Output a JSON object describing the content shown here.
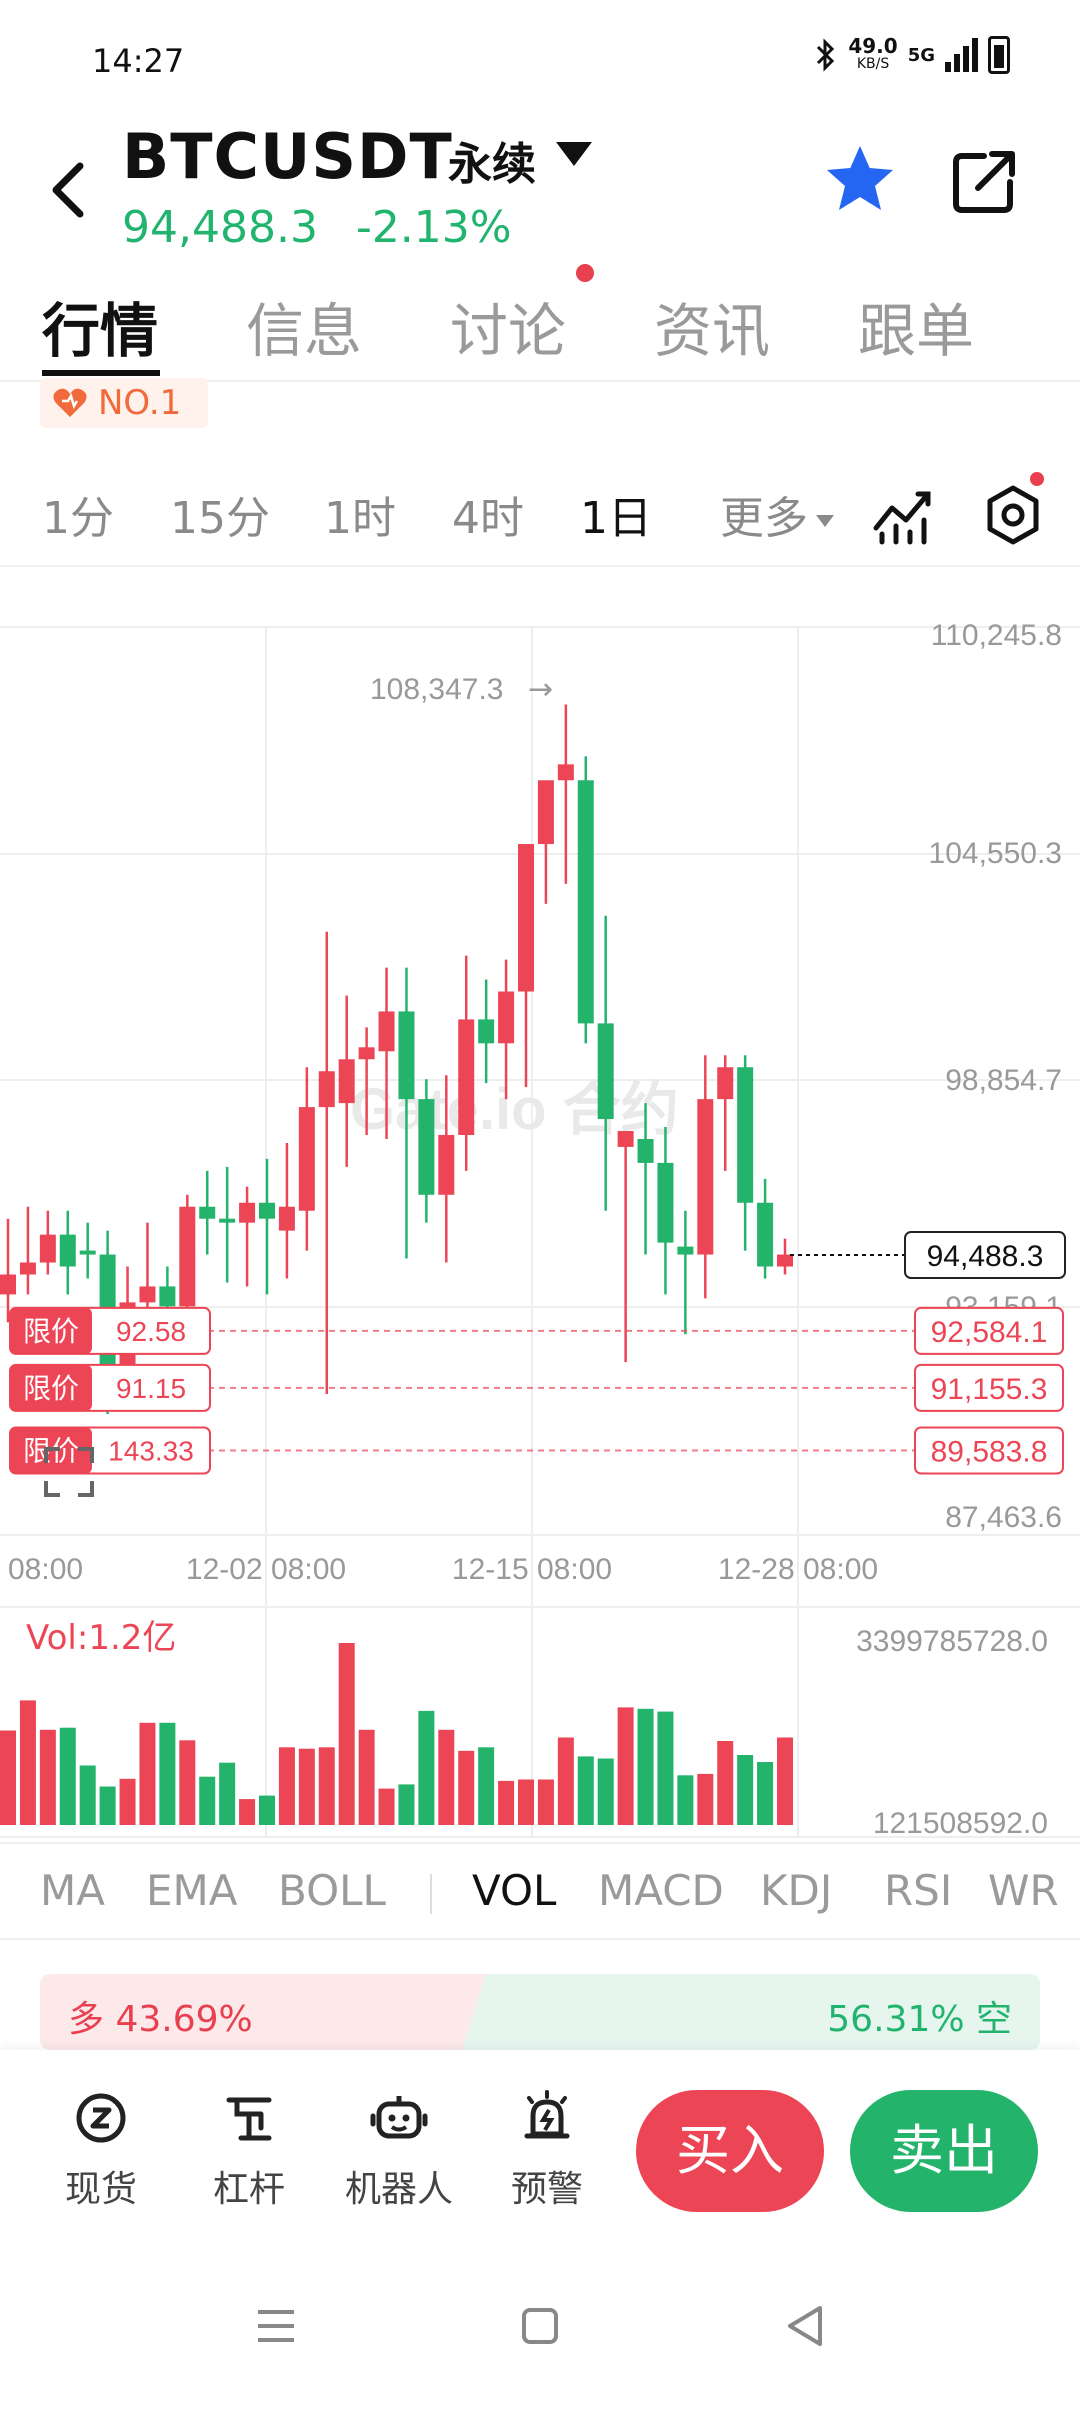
{
  "status": {
    "time": "14:27",
    "speed": "49.0",
    "speed_unit": "KB/S",
    "network": "5G"
  },
  "header": {
    "pair": "BTCUSDT",
    "contract_type": "永续",
    "price": "94,488.3",
    "change": "-2.13%",
    "price_color": "#22b46e"
  },
  "tabs": [
    {
      "label": "行情",
      "active": true
    },
    {
      "label": "信息"
    },
    {
      "label": "讨论"
    },
    {
      "label": "资讯"
    },
    {
      "label": "跟单"
    }
  ],
  "rank_badge": "NO.1",
  "timeframes": [
    "1分",
    "15分",
    "1时",
    "4时",
    "1日"
  ],
  "timeframe_active": "1日",
  "more_label": "更多",
  "chart_data": {
    "type": "candlestick",
    "watermark": "Gate.io 合约",
    "y_axis_labels": [
      "110,245.8",
      "104,550.3",
      "98,854.7",
      "93,159.1",
      "87,463.6"
    ],
    "ylim": [
      87463.6,
      110245.8
    ],
    "x_axis_labels": [
      "08:00",
      "12-02 08:00",
      "12-15 08:00",
      "12-28 08:00"
    ],
    "high_marker": "108,347.3",
    "current_price": "94,488.3",
    "current_price_value": 94488.3,
    "ohlc": [
      [
        93500,
        95400,
        92800,
        94000
      ],
      [
        94000,
        95700,
        93500,
        94300
      ],
      [
        94300,
        95600,
        94000,
        95000
      ],
      [
        95000,
        95600,
        93500,
        94200
      ],
      [
        94600,
        95300,
        93900,
        94500
      ],
      [
        94500,
        95100,
        90500,
        91500
      ],
      [
        91200,
        94200,
        91000,
        93300
      ],
      [
        93300,
        95300,
        92800,
        93700
      ],
      [
        93700,
        94200,
        92700,
        93200
      ],
      [
        93200,
        96000,
        92900,
        95700
      ],
      [
        95700,
        96600,
        94500,
        95400
      ],
      [
        95400,
        96700,
        93800,
        95300
      ],
      [
        95300,
        96200,
        93700,
        95800
      ],
      [
        95800,
        96900,
        93500,
        95400
      ],
      [
        95100,
        97300,
        93900,
        95700
      ],
      [
        95600,
        99200,
        94600,
        98200
      ],
      [
        98200,
        102600,
        91000,
        99100
      ],
      [
        98300,
        101000,
        96700,
        99400
      ],
      [
        99400,
        100200,
        97500,
        99700
      ],
      [
        99600,
        101700,
        97400,
        100600
      ],
      [
        100600,
        101700,
        94400,
        98400
      ],
      [
        98400,
        98900,
        95300,
        96000
      ],
      [
        96000,
        99000,
        94300,
        97500
      ],
      [
        97500,
        102000,
        96600,
        100400
      ],
      [
        100400,
        101400,
        98800,
        99800
      ],
      [
        99800,
        101900,
        98400,
        101100
      ],
      [
        101100,
        103500,
        98700,
        104800
      ],
      [
        104800,
        106300,
        103300,
        106400
      ],
      [
        106400,
        108300,
        103800,
        106800
      ],
      [
        106400,
        107000,
        99800,
        100300
      ],
      [
        100300,
        103000,
        95600,
        97900
      ],
      [
        97200,
        97400,
        91800,
        97600
      ],
      [
        97400,
        98300,
        94500,
        96800
      ],
      [
        96800,
        97700,
        93500,
        94800
      ],
      [
        94700,
        95600,
        92500,
        94500
      ],
      [
        94500,
        99500,
        93400,
        98400
      ],
      [
        98400,
        99500,
        96600,
        99200
      ],
      [
        99200,
        99500,
        94600,
        95800
      ],
      [
        95800,
        96400,
        93900,
        94200
      ],
      [
        94200,
        94900,
        94000,
        94500
      ]
    ],
    "volume_labels": [
      "3399785728.0",
      "121508592.0"
    ],
    "volume_title": "Vol:1.2亿",
    "volumes": [
      1.35,
      1.78,
      1.36,
      1.39,
      0.85,
      0.55,
      0.66,
      1.46,
      1.46,
      1.21,
      0.69,
      0.89,
      0.37,
      0.42,
      1.11,
      1.09,
      1.11,
      2.6,
      1.36,
      0.52,
      0.58,
      1.63,
      1.36,
      1.06,
      1.11,
      0.63,
      0.65,
      0.65,
      1.25,
      0.98,
      0.95,
      1.68,
      1.66,
      1.62,
      0.71,
      0.73,
      1.2,
      1.0,
      0.9,
      1.25
    ],
    "limit_orders": [
      {
        "tag": "限价",
        "qty": "92.58",
        "price": "92,584.1",
        "price_value": 92584.1
      },
      {
        "tag": "限价",
        "qty": "91.15",
        "price": "91,155.3",
        "price_value": 91155.3
      },
      {
        "tag": "限价",
        "qty": "143.33",
        "price": "89,583.8",
        "price_value": 89583.8
      }
    ],
    "up_color": "#ec4656",
    "down_color": "#23b36b"
  },
  "indicators": [
    "MA",
    "EMA",
    "BOLL",
    "VOL",
    "MACD",
    "KDJ",
    "RSI",
    "WR"
  ],
  "indicator_active": "VOL",
  "ratio": {
    "long_label": "多 43.69%",
    "short_label": "56.31% 空",
    "long_fraction": 0.4369
  },
  "bottom_nav": [
    {
      "label": "现货",
      "icon": "spot-icon"
    },
    {
      "label": "杠杆",
      "icon": "leverage-icon"
    },
    {
      "label": "机器人",
      "icon": "robot-icon"
    },
    {
      "label": "预警",
      "icon": "alert-icon"
    }
  ],
  "buy_label": "买入",
  "sell_label": "卖出"
}
